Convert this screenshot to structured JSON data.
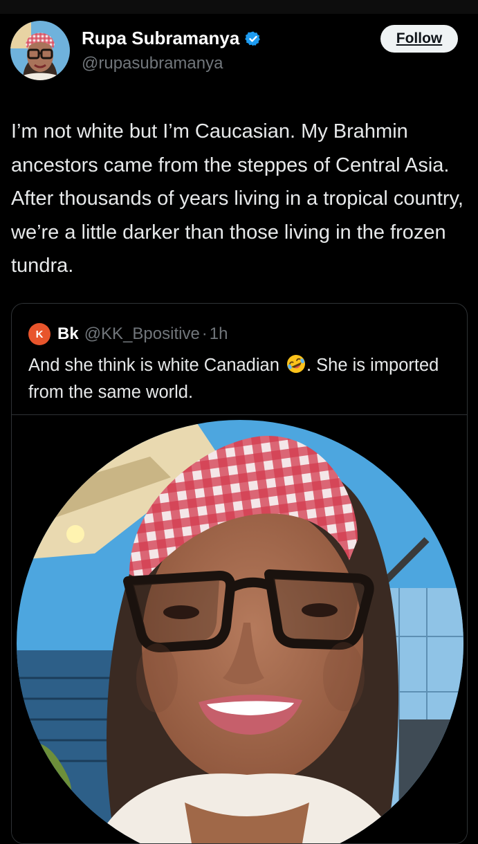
{
  "author": {
    "name": "Rupa Subramanya",
    "handle": "@rupasubramanya",
    "verified": true,
    "follow_label": "Follow"
  },
  "tweet": {
    "text": "I’m not white but I’m Caucasian. My Brahmin ancestors came from the steppes of Central Asia. After thousands of years living in a tropical country, we’re a little darker than those living in the frozen tundra."
  },
  "quote": {
    "avatar_letter": "K",
    "name": "Bk",
    "handle": "@KK_Bpositive",
    "separator": "·",
    "time": "1h",
    "text_before_emoji": "And she think is white Canadian",
    "emoji": "rolling-on-floor-laughing",
    "text_after_emoji": ". She is imported from the same world."
  },
  "colors": {
    "background": "#000000",
    "text": "#e7e9ea",
    "secondary_text": "#71767b",
    "verified_blue": "#1d9bf0",
    "border": "#2f3336",
    "quote_avatar": "#e8552c",
    "follow_bg": "#eff3f4"
  },
  "icons": {
    "verified": "verified-badge-icon",
    "emoji": "rolling-laughing-emoji-icon"
  }
}
